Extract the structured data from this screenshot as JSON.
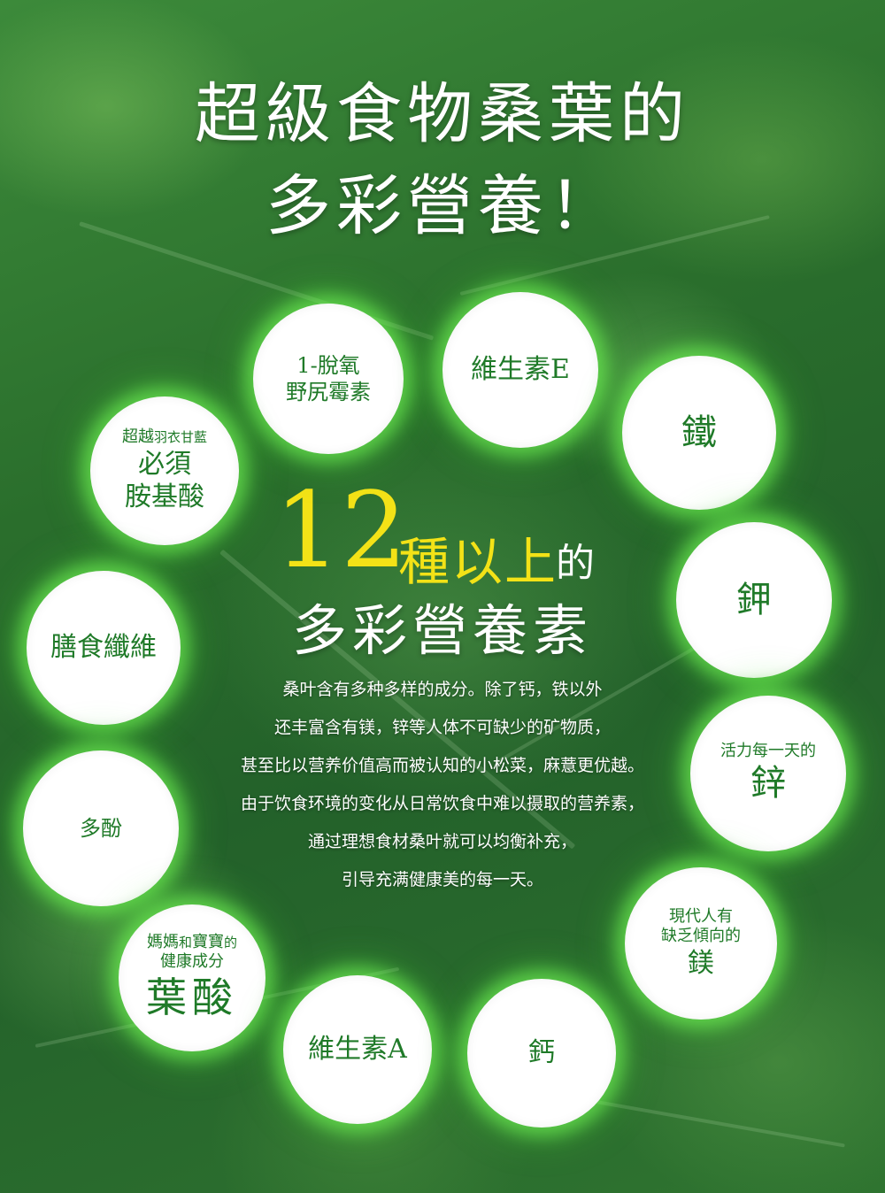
{
  "title": {
    "line1": "超級食物桑葉的",
    "line2": "多彩營養！"
  },
  "headline": {
    "number": "12",
    "kind": "種以上",
    "particle": "的",
    "subtitle": "多彩營養素"
  },
  "description": [
    "桑叶含有多种多样的成分。除了钙，铁以外",
    "还丰富含有镁，锌等人体不可缺少的矿物质，",
    "甚至比以营养价值高而被认知的小松菜，麻薏更优越。",
    "由于饮食环境的变化从日常饮食中难以摄取的营养素，",
    "通过理想食材桑叶就可以均衡补充，",
    "引导充满健康美的每一天。"
  ],
  "nutrients": {
    "deoxynojirimycin": {
      "line1": "1-脫氧",
      "line2": "野尻霉素"
    },
    "vitamin_e": "維生素E",
    "iron": "鐵",
    "amino": {
      "prefix_a": "超越",
      "prefix_b": "羽衣甘藍",
      "line2": "必須",
      "line3": "胺基酸"
    },
    "potassium": "鉀",
    "fiber": "膳食纖維",
    "zinc": {
      "caption": "活力每一天的",
      "name": "鋅"
    },
    "polyphenol": "多酚",
    "magnesium": {
      "line1": "現代人有",
      "line2": "缺乏傾向的",
      "name": "鎂"
    },
    "folic": {
      "a": "媽媽",
      "and": "和",
      "b": "寶寶",
      "of": "的",
      "line2": "健康成分",
      "name": "葉酸"
    },
    "vitamin_a": "維生素A",
    "calcium": "鈣"
  },
  "colors": {
    "headline_yellow": "#f3e217",
    "nutrient_green": "#1f7a28",
    "glow": "#78ff5a"
  }
}
